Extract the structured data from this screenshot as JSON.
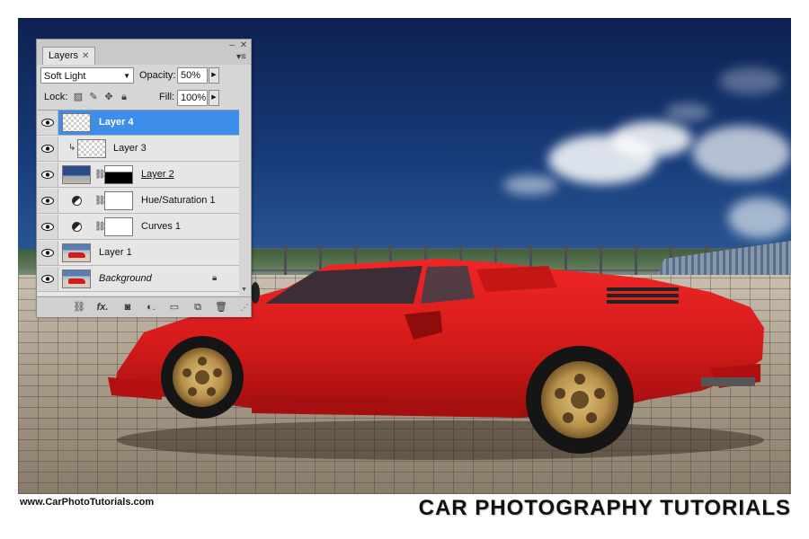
{
  "photo": {
    "subject": "red sports car on brick pavement under blue sky"
  },
  "layers_panel": {
    "tab_label": "Layers",
    "blend_mode": "Soft Light",
    "opacity_label": "Opacity:",
    "opacity_value": "50%",
    "lock_label": "Lock:",
    "fill_label": "Fill:",
    "fill_value": "100%",
    "layers": [
      {
        "name": "Layer 4",
        "selected": true,
        "thumb": "checker"
      },
      {
        "name": "Layer 3",
        "clipped": true,
        "thumb": "white"
      },
      {
        "name": "Layer 2",
        "thumb": "sky",
        "mask": "mask-black"
      },
      {
        "name": "Hue/Saturation 1",
        "adjustment": true,
        "thumb": "white"
      },
      {
        "name": "Curves 1",
        "adjustment": true,
        "thumb": "white"
      },
      {
        "name": "Layer 1",
        "thumb": "car"
      },
      {
        "name": "Background",
        "thumb": "car",
        "locked": true
      }
    ],
    "bottom_buttons": [
      "link-icon",
      "fx-icon",
      "mask-icon",
      "adjustment-icon",
      "group-folder-icon",
      "new-layer-icon",
      "trash-icon"
    ]
  },
  "captions": {
    "url": "www.CarPhotoTutorials.com",
    "brand": "CAR PHOTOGRAPHY TUTORIALS"
  },
  "colors": {
    "selection": "#3d8eea",
    "car": "#d41a1a",
    "wheel": "#b8904a"
  }
}
